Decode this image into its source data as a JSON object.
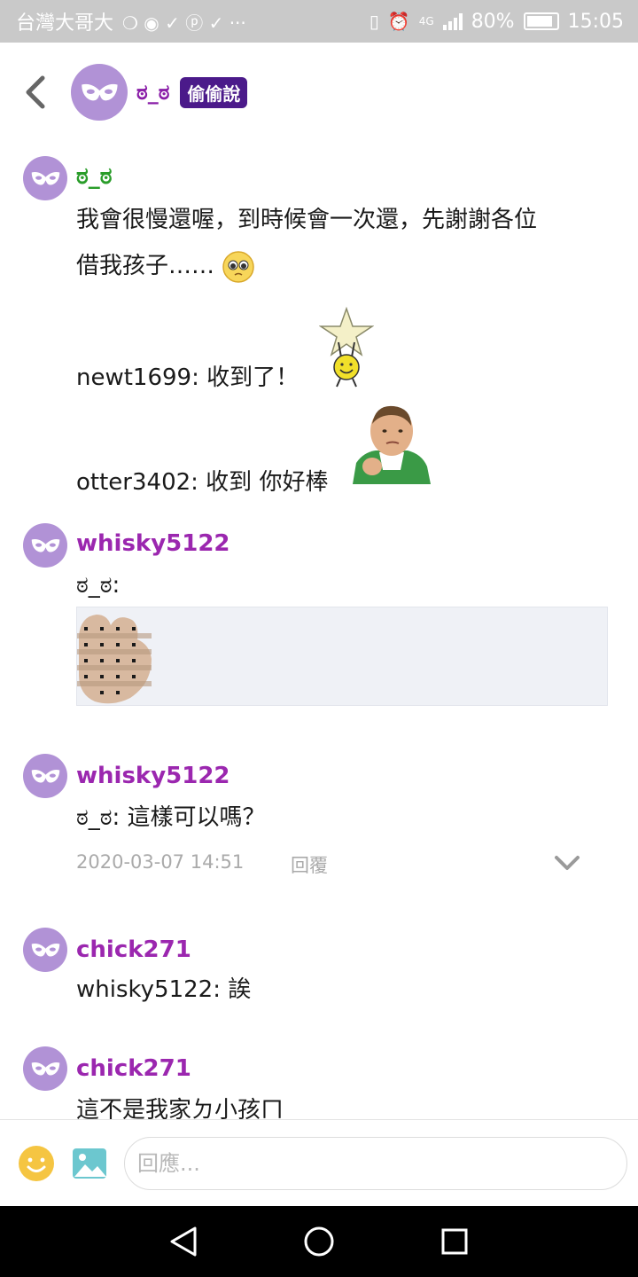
{
  "status_bar": {
    "carrier": "台灣大哥大",
    "app_glyphs": "❍ ◉ ✓ ⓟ ✓ ···",
    "network": "4G",
    "battery": "80%",
    "time": "15:05"
  },
  "header": {
    "title": "ಠ_ಠ",
    "badge": "偷偷說"
  },
  "messages": [
    {
      "username": "ಠ_ಠ",
      "name_color": "#2a9d2a",
      "lines": [
        "我會很慢還喔，到時候會一次還，先謝謝各位",
        "借我孩子……",
        "newt1699: 收到了！",
        "otter3402: 收到 你好棒"
      ]
    },
    {
      "username": "whisky5122",
      "name_color": "#9b27af",
      "lines": [
        "ಠ_ಠ:"
      ]
    },
    {
      "username": "whisky5122",
      "name_color": "#9b27af",
      "lines": [
        "ಠ_ಠ: 這樣可以嗎？"
      ],
      "timestamp": "2020-03-07 14:51",
      "reply_label": "回覆"
    },
    {
      "username": "chick271",
      "name_color": "#9b27af",
      "lines": [
        "whisky5122: 誒"
      ]
    },
    {
      "username": "chick271",
      "name_color": "#9b27af",
      "lines": [
        "這不是我家ㄉ小孩ㄇ"
      ]
    }
  ],
  "input": {
    "placeholder": "回應..."
  },
  "colors": {
    "accent": "#9b27af",
    "badge_bg": "#4b1a8a",
    "avatar_bg": "#b192d6"
  },
  "icons": {
    "back": "chevron-left-icon",
    "avatar": "mask-icon",
    "emoji": "smiley-icon",
    "image": "image-icon",
    "expand": "chevron-down-icon"
  }
}
